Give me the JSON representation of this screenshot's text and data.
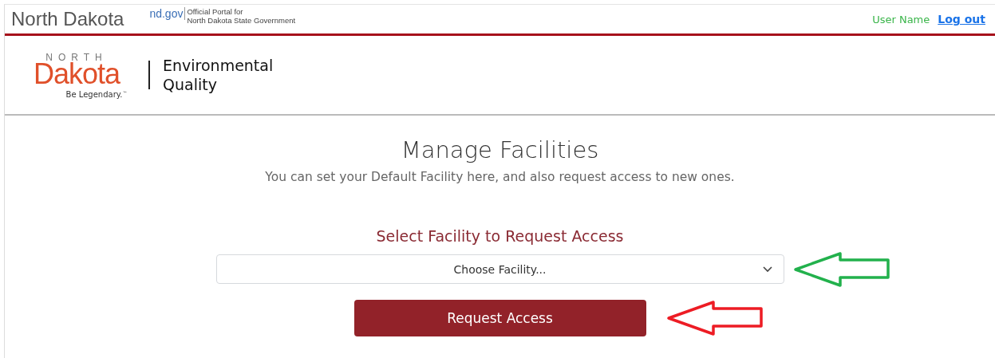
{
  "top_bar": {
    "state_name": "North Dakota",
    "portal_domain": "nd.gov",
    "portal_tagline_1": "Official Portal for",
    "portal_tagline_2": "North Dakota State Government",
    "user_name": "User Name",
    "logout_link": "Log out"
  },
  "logo": {
    "north": "NORTH",
    "dakota": "Dakota",
    "slogan": "Be Legendary.",
    "trademark": "™",
    "department_1": "Environmental",
    "department_2": "Quality"
  },
  "page": {
    "title": "Manage Facilities",
    "subtitle": "You can set your Default Facility here, and also request access to new ones.",
    "select_label": "Select Facility to Request Access",
    "select": {
      "placeholder": "Choose Facility..."
    },
    "button": "Request Access"
  },
  "annotations": [
    {
      "color": "#22b14c"
    },
    {
      "color": "#ed1c24"
    }
  ]
}
